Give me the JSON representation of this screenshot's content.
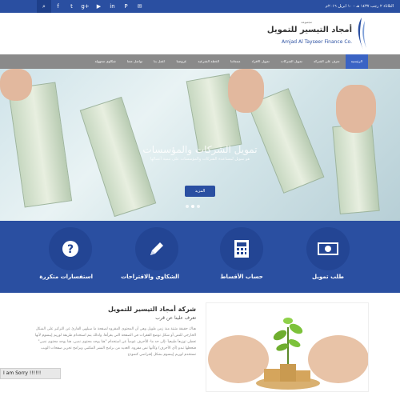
{
  "topbar": {
    "date": "الثلاثاء ٢ رجب ١٤٣٧ هـ - ١٠ ابريل ٢٠١٦م",
    "social": [
      "f",
      "t",
      "g+",
      "▶",
      "in",
      "P",
      "✉"
    ],
    "search_icon": "search-icon"
  },
  "header": {
    "logo_small": "مجموعة",
    "logo_ar": "أمجاد التيسير للتمويل",
    "logo_en": "Amjad Al Tayseer Finance Co."
  },
  "nav": {
    "items": [
      {
        "label": "الرئيسية",
        "active": true
      },
      {
        "label": "تعرف على الشركة",
        "active": false
      },
      {
        "label": "تمويل الشركات",
        "active": false
      },
      {
        "label": "تمويل الافراد",
        "active": false
      },
      {
        "label": "منتجاتنا",
        "active": false
      },
      {
        "label": "الخطة الشرعية",
        "active": false
      },
      {
        "label": "عروضنا",
        "active": false
      },
      {
        "label": "اعمل بنا",
        "active": false
      },
      {
        "label": "تواصل معنا",
        "active": false
      },
      {
        "label": "شكاوى مجهولة",
        "active": false
      }
    ]
  },
  "hero": {
    "title": "تمويل الشركات والمؤسسات",
    "subtitle": "هو تمويل لمساعدة الشركات والمؤسسات على تنمية أعمالها",
    "button": "المزيد",
    "slides": 3,
    "active_slide": 1
  },
  "services": [
    {
      "label": "طلب تمويل",
      "icon": "money-icon"
    },
    {
      "label": "حساب الأقساط",
      "icon": "calculator-icon"
    },
    {
      "label": "الشكاوي والاقتراحات",
      "icon": "pencil-icon"
    },
    {
      "label": "استفسارات متكررة",
      "icon": "question-icon"
    }
  ],
  "about": {
    "title": "شركة أمجاد التيسير للتمويل",
    "subtitle": "تعرف علينا عن قرب",
    "text": "هناك حقيقة مثبتة منذ زمن طويل وهي أن المحتوى المقروء لصفحة ما سيلهي القارئ عن التركيز على الشكل الخارجي للنص أو شكل توضع الفقرات في الصفحة التي يقرأها. ولذلك يتم استخدام طريقة لوريم إيبسوم لأنها تعطي توزيعاَ طبيعياَ -إلى حد ما- للأحرف عوضاً عن استخدام \"هنا يوجد محتوى نصي، هنا يوجد محتوى نصي\" فتجعلها تبدو (أي الأحرف) وكأنها نص مقروء. العديد من برامح النشر المكتبي وبرامح تحرير صفحات الويب تستخدم لوريم إيبسوم بشكل إفتراضي كنموذج"
  },
  "notice": {
    "text": "I am Sorry !!!!!!"
  }
}
